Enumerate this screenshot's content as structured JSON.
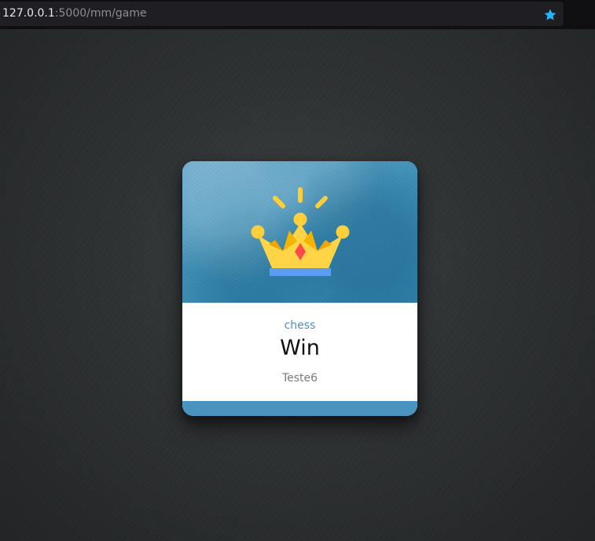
{
  "browser": {
    "url_host": "127.0.0.1",
    "url_path": ":5000/mm/game",
    "bookmark_icon": "star-icon",
    "bookmark_color": "#1fb6ff"
  },
  "card": {
    "image_icon": "crown-icon",
    "category": "chess",
    "result": "Win",
    "player": "Teste6",
    "accent_color": "#4a93bf"
  }
}
